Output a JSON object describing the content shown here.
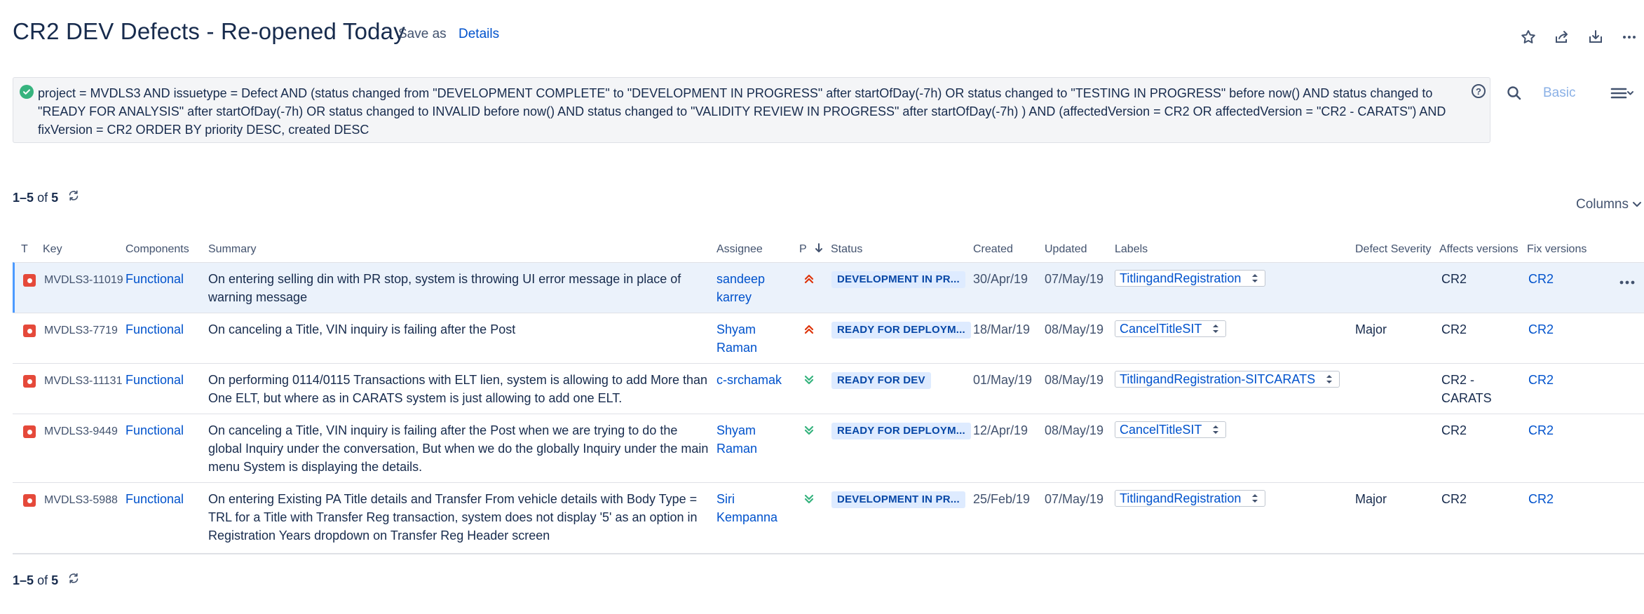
{
  "header": {
    "title": "CR2 DEV Defects - Re-opened Today",
    "save_as": "Save as",
    "details": "Details"
  },
  "jql": {
    "query": "project = MVDLS3 AND issuetype = Defect AND (status changed from \"DEVELOPMENT COMPLETE\" to \"DEVELOPMENT IN PROGRESS\" after startOfDay(-7h)  OR status changed to \"TESTING IN PROGRESS\" before now()  AND status changed to \"READY FOR ANALYSIS\" after startOfDay(-7h)  OR status changed to INVALID before now()  AND status changed to \"VALIDITY REVIEW IN PROGRESS\" after startOfDay(-7h) ) AND (affectedVersion = CR2 OR affectedVersion = \"CR2 - CARATS\") AND fixVersion = CR2 ORDER BY priority DESC, created DESC",
    "basic_label": "Basic"
  },
  "pagination": {
    "range": "1–5",
    "of": "of",
    "total": "5"
  },
  "columns_label": "Columns",
  "table": {
    "headers": {
      "t": "T",
      "key": "Key",
      "components": "Components",
      "summary": "Summary",
      "assignee": "Assignee",
      "p": "P",
      "status": "Status",
      "created": "Created",
      "updated": "Updated",
      "labels": "Labels",
      "severity": "Defect Severity",
      "affects": "Affects versions",
      "fix": "Fix versions"
    },
    "rows": [
      {
        "key": "MVDLS3-11019",
        "component": "Functional",
        "summary": "On entering selling din with PR stop, system is throwing UI error message in place of warning message",
        "assignee": "sandeep karrey",
        "priority": "highest",
        "status": "DEVELOPMENT IN PR...",
        "created": "30/Apr/19",
        "updated": "07/May/19",
        "label": "TitlingandRegistration",
        "severity": "",
        "affects": "CR2",
        "fix": "CR2"
      },
      {
        "key": "MVDLS3-7719",
        "component": "Functional",
        "summary": "On canceling a Title, VIN inquiry is failing after the Post",
        "assignee": "Shyam Raman",
        "priority": "highest",
        "status": "READY FOR DEPLOYM...",
        "created": "18/Mar/19",
        "updated": "08/May/19",
        "label": "CancelTitleSIT",
        "severity": "Major",
        "affects": "CR2",
        "fix": "CR2"
      },
      {
        "key": "MVDLS3-11131",
        "component": "Functional",
        "summary": "On performing 0114/0115 Transactions with ELT lien, system is allowing to add More than One ELT, but where as in CARATS system is just allowing to add one ELT.",
        "assignee": "c-srchamak",
        "priority": "lowest",
        "status": "READY FOR DEV",
        "created": "01/May/19",
        "updated": "08/May/19",
        "label": "TitlingandRegistration-SITCARATS",
        "severity": "",
        "affects": "CR2 - CARATS",
        "fix": "CR2"
      },
      {
        "key": "MVDLS3-9449",
        "component": "Functional",
        "summary": "On canceling a Title, VIN inquiry is failing after the Post when we are trying to do the global Inquiry under the conversation, But when we do the globally Inquiry under the main menu System is displaying the details.",
        "assignee": "Shyam Raman",
        "priority": "lowest",
        "status": "READY FOR DEPLOYM...",
        "created": "12/Apr/19",
        "updated": "08/May/19",
        "label": "CancelTitleSIT",
        "severity": "",
        "affects": "CR2",
        "fix": "CR2"
      },
      {
        "key": "MVDLS3-5988",
        "component": "Functional",
        "summary": "On entering Existing PA Title details and Transfer From vehicle details with Body Type = TRL for a Title with Transfer Reg transaction, system does not display '5' as an option in Registration Years dropdown on Transfer Reg Header screen",
        "assignee": "Siri Kempanna",
        "priority": "lowest",
        "status": "DEVELOPMENT IN PR...",
        "created": "25/Feb/19",
        "updated": "07/May/19",
        "label": "TitlingandRegistration",
        "severity": "Major",
        "affects": "CR2",
        "fix": "CR2"
      }
    ]
  },
  "colors": {
    "link": "#0052cc",
    "priority_high": "#de350b",
    "priority_low": "#36b37e",
    "bug_red": "#e5493a",
    "status_bg": "#deebff"
  }
}
